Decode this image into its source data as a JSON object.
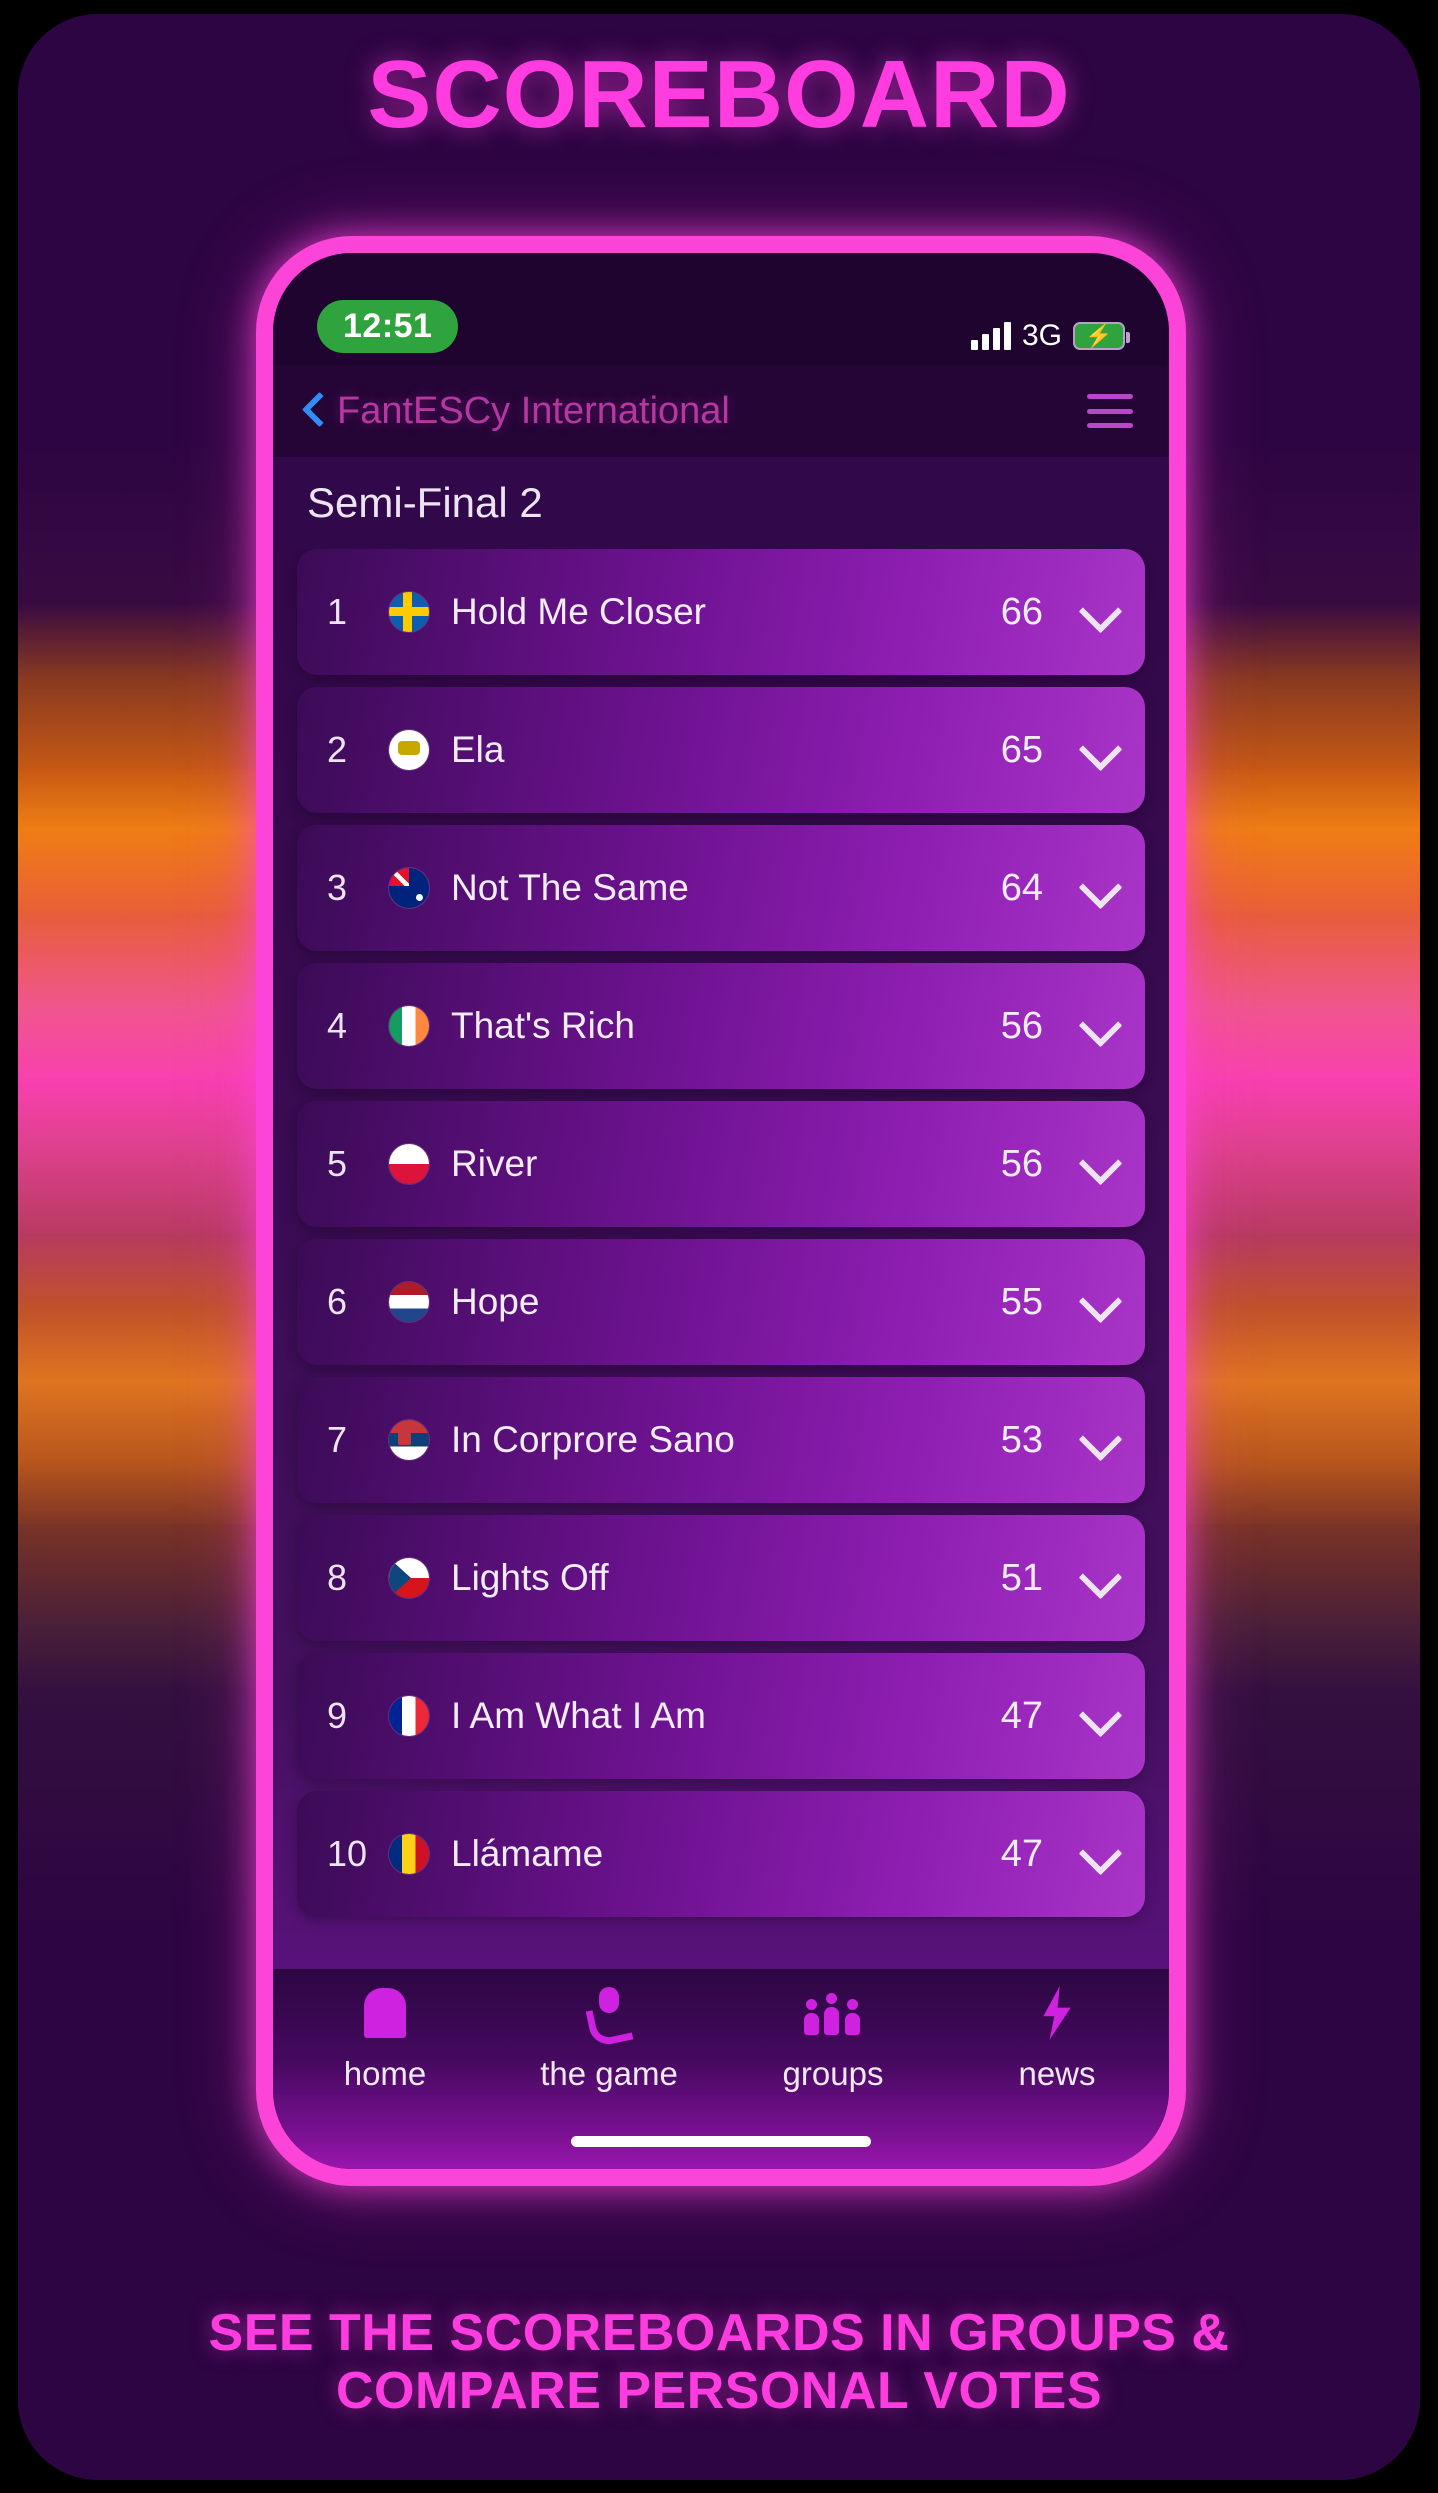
{
  "poster": {
    "headline": "SCOREBOARD",
    "caption_line1": "SEE THE SCOREBOARDS IN GROUPS &",
    "caption_line2": "COMPARE PERSONAL VOTES",
    "accent_pink": "#ff3ce0",
    "frame_pink": "#fc44d8",
    "background_purple": "#2d0542"
  },
  "status_bar": {
    "time": "12:51",
    "network": "3G",
    "signal_icon": "signal-bars-icon",
    "battery_icon": "battery-charging-icon",
    "time_pill_color": "#2fa33e"
  },
  "nav": {
    "back_icon": "back-chevron-icon",
    "title": "FantESCy International",
    "menu_icon": "hamburger-menu-icon"
  },
  "section": {
    "title": "Semi-Final 2"
  },
  "scoreboard": {
    "expand_icon": "chevron-down-icon",
    "rows": [
      {
        "rank": "1",
        "song": "Hold Me Closer",
        "score": "66",
        "flag": "flag-sweden",
        "flag_colors": [
          "#0d5eaf",
          "#fecb00"
        ]
      },
      {
        "rank": "2",
        "song": "Ela",
        "score": "65",
        "flag": "flag-cyprus",
        "flag_colors": [
          "#ffffff",
          "#c8a700"
        ]
      },
      {
        "rank": "3",
        "song": "Not The Same",
        "score": "64",
        "flag": "flag-australia",
        "flag_colors": [
          "#00247d",
          "#e8112d"
        ]
      },
      {
        "rank": "4",
        "song": "That's Rich",
        "score": "56",
        "flag": "flag-ireland",
        "flag_colors": [
          "#169b62",
          "#ff883e"
        ]
      },
      {
        "rank": "5",
        "song": "River",
        "score": "56",
        "flag": "flag-poland",
        "flag_colors": [
          "#ffffff",
          "#dc143c"
        ]
      },
      {
        "rank": "6",
        "song": "Hope",
        "score": "55",
        "flag": "flag-netherlands",
        "flag_colors": [
          "#ae1c28",
          "#21468b"
        ]
      },
      {
        "rank": "7",
        "song": "In Corprore Sano",
        "score": "53",
        "flag": "flag-serbia",
        "flag_colors": [
          "#c6363c",
          "#0c4076"
        ]
      },
      {
        "rank": "8",
        "song": "Lights Off",
        "score": "51",
        "flag": "flag-czechia",
        "flag_colors": [
          "#d7141a",
          "#11457e"
        ]
      },
      {
        "rank": "9",
        "song": "I Am What I Am",
        "score": "47",
        "flag": "flag-france",
        "flag_colors": [
          "#002395",
          "#ed2939"
        ]
      },
      {
        "rank": "10",
        "song": "Llámame",
        "score": "47",
        "flag": "flag-romania",
        "flag_colors": [
          "#002b7f",
          "#ce1126"
        ]
      }
    ]
  },
  "tabbar": {
    "tabs": [
      {
        "label": "home",
        "icon": "home-icon"
      },
      {
        "label": "the game",
        "icon": "microphone-icon"
      },
      {
        "label": "groups",
        "icon": "people-group-icon"
      },
      {
        "label": "news",
        "icon": "lightning-bolt-icon"
      }
    ]
  }
}
